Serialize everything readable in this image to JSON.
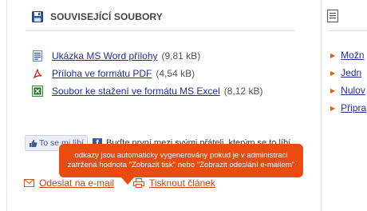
{
  "left_box": {
    "title": "SOUVISEJÍCÍ SOUBORY",
    "files": [
      {
        "type": "word",
        "icon": "word-doc-icon",
        "name": "Ukázka MS Word přílohy",
        "size": "(9,81 kB)"
      },
      {
        "type": "pdf",
        "icon": "pdf-icon",
        "name": "Příloha ve formátu PDF",
        "size": "(4,54 kB)"
      },
      {
        "type": "excel",
        "icon": "excel-icon",
        "name": "Soubor ke stažení ve formátu MS Excel",
        "size": "(8,12 kB)"
      }
    ]
  },
  "social": {
    "like_label": "To se mi líbí",
    "fb_text": "Buďte první mezi svými přáteli, kterým se to líbí."
  },
  "tooltip": {
    "line1": "odkazy jsou automaticky vygenerovány pokud je v administraci",
    "line2": "zatržená hodnota \"Zobrazit tisk\" nebo \"Zobrazit odeslání e-mailem\""
  },
  "actions": {
    "email_label": "Odeslat na e-mail",
    "print_label": "Tisknout článek"
  },
  "right_box": {
    "links": [
      "Možn",
      "Jedn",
      "Nulov",
      "Připra"
    ]
  },
  "colors": {
    "link": "#1f2d9a",
    "accent": "#ea4b0e",
    "action_link": "#c8420a"
  }
}
